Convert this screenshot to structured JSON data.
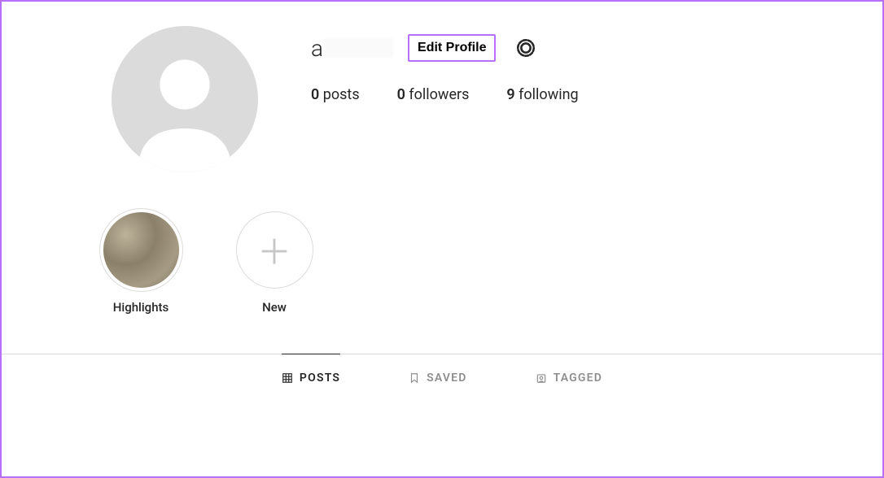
{
  "profile": {
    "username_visible": "a",
    "edit_button": "Edit Profile",
    "stats": {
      "posts_count": "0",
      "posts_label": "posts",
      "followers_count": "0",
      "followers_label": "followers",
      "following_count": "9",
      "following_label": "following"
    }
  },
  "highlights": [
    {
      "label": "Highlights",
      "type": "filled"
    },
    {
      "label": "New",
      "type": "add"
    }
  ],
  "tabs": {
    "posts": "POSTS",
    "saved": "SAVED",
    "tagged": "TAGGED"
  }
}
